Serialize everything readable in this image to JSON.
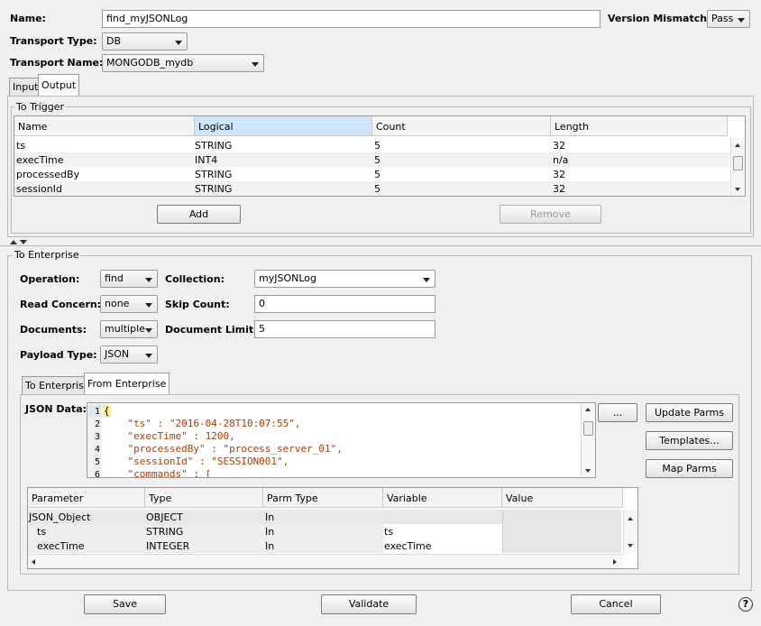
{
  "header": {
    "name_label": "Name:",
    "name_value": "find_myJSONLog",
    "version_label": "Version Mismatch:",
    "version_value": "Pass",
    "transport_type_label": "Transport Type:",
    "transport_type_value": "DB",
    "transport_name_label": "Transport Name:",
    "transport_name_value": "MONGODB_mydb"
  },
  "tabs": {
    "input": "Input",
    "output": "Output"
  },
  "to_trigger": {
    "title": "To Trigger",
    "columns": [
      "Name",
      "Logical",
      "Count",
      "Length"
    ],
    "rows": [
      [
        "ts",
        "STRING",
        "5",
        "32"
      ],
      [
        "execTime",
        "INT4",
        "5",
        "n/a"
      ],
      [
        "processedBy",
        "STRING",
        "5",
        "32"
      ],
      [
        "sessionId",
        "STRING",
        "5",
        "32"
      ]
    ],
    "add_label": "Add",
    "remove_label": "Remove"
  },
  "to_enterprise": {
    "title": "To Enterprise",
    "operation_label": "Operation:",
    "operation_value": "find",
    "collection_label": "Collection:",
    "collection_value": "myJSONLog",
    "read_concern_label": "Read Concern:",
    "read_concern_value": "none",
    "skip_count_label": "Skip Count:",
    "skip_count_value": "0",
    "documents_label": "Documents:",
    "documents_value": "multiple",
    "document_limit_label": "Document Limit:",
    "document_limit_value": "5",
    "payload_type_label": "Payload Type:",
    "payload_type_value": "JSON",
    "subtabs": {
      "to_enterprise": "To Enterprise",
      "from_enterprise": "From Enterprise"
    },
    "json_data_label": "JSON Data:",
    "ellipsis_label": "...",
    "code_lines": [
      "{",
      "    \"ts\" : \"2016-04-28T10:07:55\",",
      "    \"execTime\" : 1200,",
      "    \"processedBy\" : \"process_server_01\",",
      "    \"sessionId\" : \"SESSION001\",",
      "    \"commands\" : ["
    ],
    "line_numbers": [
      "1",
      "2",
      "3",
      "4",
      "5",
      "6"
    ],
    "update_parms_label": "Update Parms",
    "templates_label": "Templates...",
    "map_parms_label": "Map Parms",
    "params_columns": [
      "Parameter",
      "Type",
      "Parm Type",
      "Variable",
      "Value"
    ],
    "params_rows": [
      [
        "JSON_Object",
        "OBJECT",
        "In",
        "",
        ""
      ],
      [
        "ts",
        "STRING",
        "In",
        "ts",
        ""
      ],
      [
        "execTime",
        "INTEGER",
        "In",
        "execTime",
        ""
      ]
    ]
  },
  "footer": {
    "save_label": "Save",
    "validate_label": "Validate",
    "cancel_label": "Cancel",
    "help_label": "?"
  }
}
